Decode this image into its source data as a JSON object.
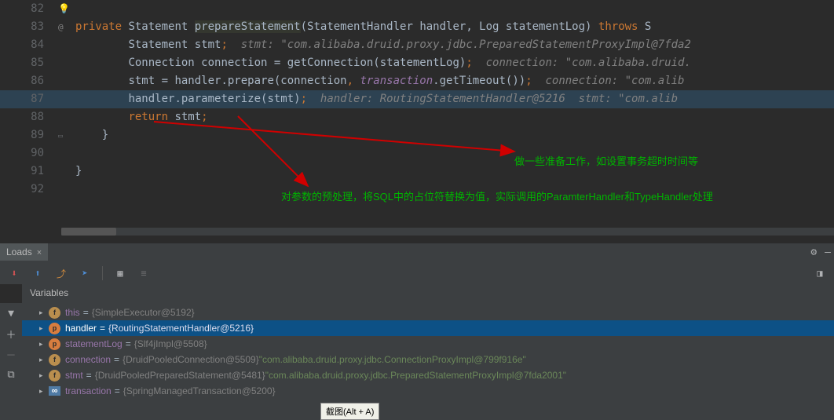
{
  "lines": {
    "l82": {
      "num": "82"
    },
    "l83": {
      "num": "83",
      "kw1": "private",
      "type1": "Statement",
      "method": "prepareStatement",
      "sig": "(StatementHandler handler, Log statementLog) ",
      "kw2": "throws",
      "tail": " S"
    },
    "l84": {
      "num": "84",
      "indent": "        ",
      "t1": "Statement stmt",
      "semi": ";",
      "c": "  stmt: \"com.alibaba.druid.proxy.jdbc.PreparedStatementProxyImpl@7fda2"
    },
    "l85": {
      "num": "85",
      "indent": "        ",
      "t1": "Connection connection = getConnection(statementLog)",
      "semi": ";",
      "c": "  connection: \"com.alibaba.druid."
    },
    "l86": {
      "num": "86",
      "indent": "        ",
      "t1": "stmt = handler.prepare(connection",
      "comma": ", ",
      "t2": "transaction",
      "t3": ".getTimeout())",
      "semi": ";",
      "c": "  connection: \"com.alib"
    },
    "l87": {
      "num": "87",
      "indent": "        ",
      "t1": "handler.parameterize(stmt)",
      "semi": ";",
      "c": "  handler: RoutingStatementHandler@5216  stmt: \"com.alib"
    },
    "l88": {
      "num": "88",
      "indent": "        ",
      "kw": "return",
      "t1": " stmt",
      "semi": ";"
    },
    "l89": {
      "num": "89",
      "t1": "    }"
    },
    "l90": {
      "num": "90"
    },
    "l91": {
      "num": "91",
      "t1": "}"
    },
    "l92": {
      "num": "92"
    }
  },
  "annotations": {
    "a1": "做一些准备工作，如设置事务超时时间等",
    "a2": "对参数的预处理，将SQL中的占位符替换为值，实际调用的ParamterHandler和TypeHandler处理"
  },
  "tab": {
    "label": "Loads",
    "close": "×"
  },
  "toolbar": {},
  "vars_header": "Variables",
  "nodes": [
    {
      "sel": false,
      "badge": "f",
      "bc": "b-f",
      "name": "this",
      "eq": " = ",
      "obj": "{SimpleExecutor@5192}",
      "str": ""
    },
    {
      "sel": true,
      "badge": "p",
      "bc": "b-p",
      "name": "handler",
      "eq": " = ",
      "obj": "{RoutingStatementHandler@5216}",
      "str": ""
    },
    {
      "sel": false,
      "badge": "p",
      "bc": "b-p",
      "name": "statementLog",
      "eq": " = ",
      "obj": "{Slf4jImpl@5508}",
      "str": ""
    },
    {
      "sel": false,
      "badge": "f",
      "bc": "b-f",
      "name": "connection",
      "eq": " = ",
      "obj": "{DruidPooledConnection@5509} ",
      "str": "\"com.alibaba.druid.proxy.jdbc.ConnectionProxyImpl@799f916e\""
    },
    {
      "sel": false,
      "badge": "f",
      "bc": "b-f",
      "name": "stmt",
      "eq": " = ",
      "obj": "{DruidPooledPreparedStatement@5481} ",
      "str": "\"com.alibaba.druid.proxy.jdbc.PreparedStatementProxyImpl@7fda2001\""
    },
    {
      "sel": false,
      "badge": "∞",
      "bc": "b-inf",
      "name": "transaction",
      "eq": " = ",
      "obj": "{SpringManagedTransaction@5200}",
      "str": ""
    }
  ],
  "tooltip": "截图(Alt + A)"
}
